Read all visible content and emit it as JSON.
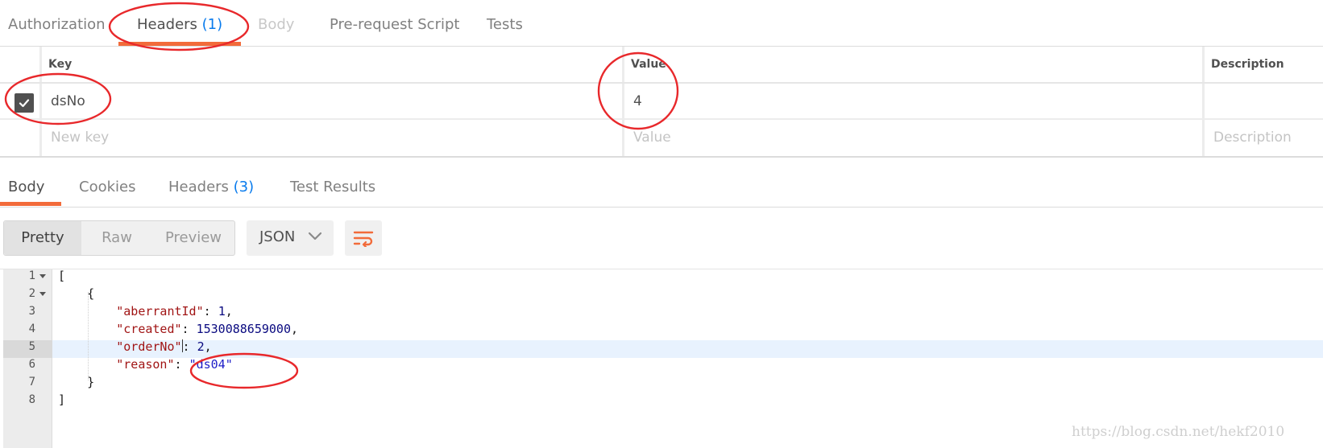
{
  "request_tabs": [
    {
      "label": "Authorization",
      "count": ""
    },
    {
      "label": "Headers",
      "count": "(1)"
    },
    {
      "label": "Body",
      "count": ""
    },
    {
      "label": "Pre-request Script",
      "count": ""
    },
    {
      "label": "Tests",
      "count": ""
    }
  ],
  "headers_table": {
    "columns": {
      "key": "Key",
      "value": "Value",
      "description": "Description"
    },
    "rows": [
      {
        "enabled": true,
        "key": "dsNo",
        "value": "4",
        "description": ""
      }
    ],
    "new_row": {
      "key_placeholder": "New key",
      "value_placeholder": "Value",
      "description_placeholder": "Description"
    }
  },
  "response_tabs": [
    {
      "label": "Body",
      "count": ""
    },
    {
      "label": "Cookies",
      "count": ""
    },
    {
      "label": "Headers",
      "count": "(3)"
    },
    {
      "label": "Test Results",
      "count": ""
    }
  ],
  "view_modes": {
    "pretty": "Pretty",
    "raw": "Raw",
    "preview": "Preview",
    "selected": "Pretty"
  },
  "format": {
    "selected": "JSON"
  },
  "code": {
    "line_numbers": [
      "1",
      "2",
      "3",
      "4",
      "5",
      "6",
      "7",
      "8"
    ],
    "active_line": 5,
    "open_bracket": "[",
    "open_brace": "{",
    "fields": [
      {
        "key": "\"aberrantId\"",
        "value": "1",
        "type": "number"
      },
      {
        "key": "\"created\"",
        "value": "1530088659000",
        "type": "number"
      },
      {
        "key": "\"orderNo\"",
        "value": "2",
        "type": "number"
      },
      {
        "key": "\"reason\"",
        "value": "\"ds04\"",
        "type": "string"
      }
    ],
    "close_brace": "}",
    "close_bracket": "]"
  },
  "watermark": "https://blog.csdn.net/hekf2010",
  "colors": {
    "accent": "#f26b3a",
    "count": "#097bed",
    "annotation": "#e8282b"
  },
  "icons": {
    "checkbox": "checkmark-icon",
    "format": "chevron-down-icon",
    "wrap": "wrap-lines-icon",
    "fold": "fold-arrow-icon"
  }
}
